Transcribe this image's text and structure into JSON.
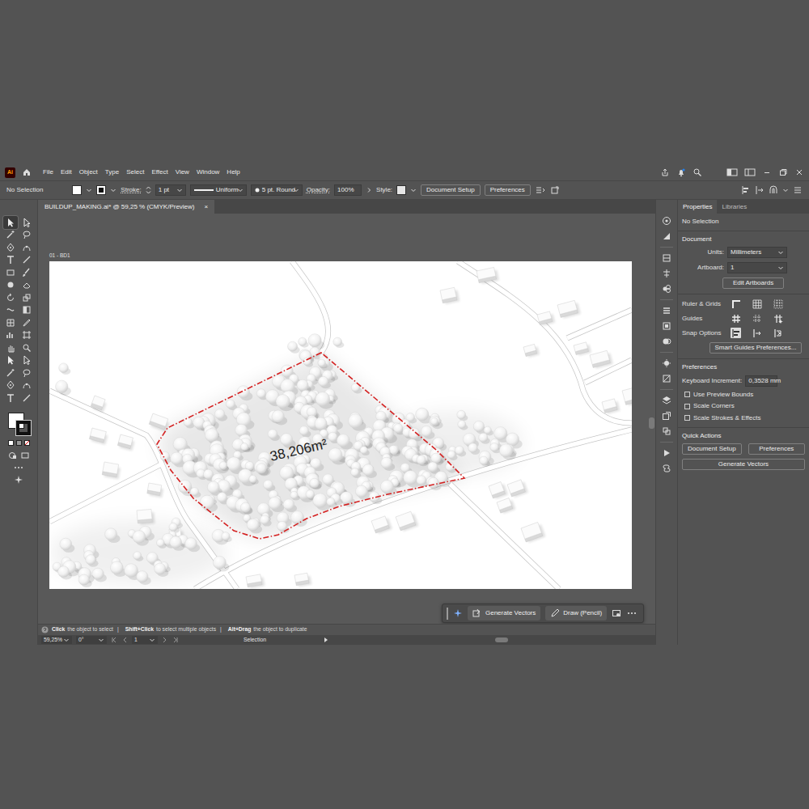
{
  "app": {
    "logo": "Ai",
    "menus": [
      "File",
      "Edit",
      "Object",
      "Type",
      "Select",
      "Effect",
      "View",
      "Window",
      "Help"
    ]
  },
  "control_bar": {
    "selection": "No Selection",
    "stroke_label": "Stroke:",
    "stroke_weight": "1 pt",
    "profile": "Uniform",
    "brush": "5 pt. Round",
    "opacity_label": "Opacity:",
    "opacity": "100%",
    "style_label": "Style:",
    "buttons": [
      "Document Setup",
      "Preferences"
    ]
  },
  "toolbar": {
    "tools": [
      {
        "selected": true
      },
      {
        "selected": false
      },
      {
        "selected": false
      },
      {
        "selected": false
      },
      {
        "selected": false
      },
      {
        "selected": false
      },
      {
        "selected": false
      },
      {
        "selected": false
      },
      {
        "selected": false
      },
      {
        "selected": false
      },
      {
        "selected": false
      },
      {
        "selected": false
      },
      {
        "selected": false
      },
      {
        "selected": false
      },
      {
        "selected": false
      },
      {
        "selected": false
      },
      {
        "selected": false
      },
      {
        "selected": false
      },
      {
        "selected": false
      },
      {
        "selected": false
      },
      {
        "selected": false
      },
      {
        "selected": false
      },
      {
        "selected": false
      },
      {
        "selected": false
      },
      {
        "selected": false
      },
      {
        "selected": false
      },
      {
        "selected": false
      },
      {
        "selected": false
      },
      {
        "selected": false
      },
      {
        "selected": false
      }
    ]
  },
  "document_tab": {
    "title": "BUILDUP_MAKING.ai* @ 59,25 % (CMYK/Preview)",
    "close": "×"
  },
  "artboard": {
    "label": "01 - BD1",
    "area_label": "38,206m²"
  },
  "taskbar": {
    "buttons": [
      "Generate Vectors",
      "Draw (Pencil)"
    ]
  },
  "hint": {
    "separator": "|",
    "items": [
      {
        "key": "Click",
        "text": "the object to select"
      },
      {
        "key": "Shift+Click",
        "text": "to select multiple objects"
      },
      {
        "key": "Alt+Drag",
        "text": "the object to duplicate"
      }
    ]
  },
  "status_bar": {
    "zoom": "59,25%",
    "rotation": "0°",
    "artboard": "1",
    "tool": "Selection"
  },
  "panel": {
    "tabs": [
      {
        "label": "Properties",
        "selected": true
      },
      {
        "label": "Libraries",
        "selected": false
      }
    ],
    "selection": "No Selection",
    "document": {
      "title": "Document",
      "units_label": "Units:",
      "units": "Millimeters",
      "artboard_label": "Artboard:",
      "artboard": "1",
      "edit_button": "Edit Artboards"
    },
    "rows": [
      {
        "label": "Ruler & Grids",
        "icons": [
          {
            "selected": false
          },
          {
            "selected": false
          },
          {
            "selected": false
          }
        ]
      },
      {
        "label": "Guides",
        "icons": [
          {
            "selected": false
          },
          {
            "selected": false
          },
          {
            "selected": false
          }
        ]
      },
      {
        "label": "Snap Options",
        "icons": [
          {
            "selected": true
          },
          {
            "selected": false
          },
          {
            "selected": false
          }
        ]
      }
    ],
    "smart_guides_button": "Smart Guides Preferences...",
    "preferences": {
      "title": "Preferences",
      "increment_label": "Keyboard Increment:",
      "increment": "0,3528 mm",
      "options": [
        {
          "label": "Use Preview Bounds",
          "checked": false
        },
        {
          "label": "Scale Corners",
          "checked": false
        },
        {
          "label": "Scale Strokes & Effects",
          "checked": false
        }
      ]
    },
    "quick_actions": {
      "title": "Quick Actions",
      "buttons": [
        "Document Setup",
        "Preferences",
        "Generate Vectors"
      ]
    }
  }
}
